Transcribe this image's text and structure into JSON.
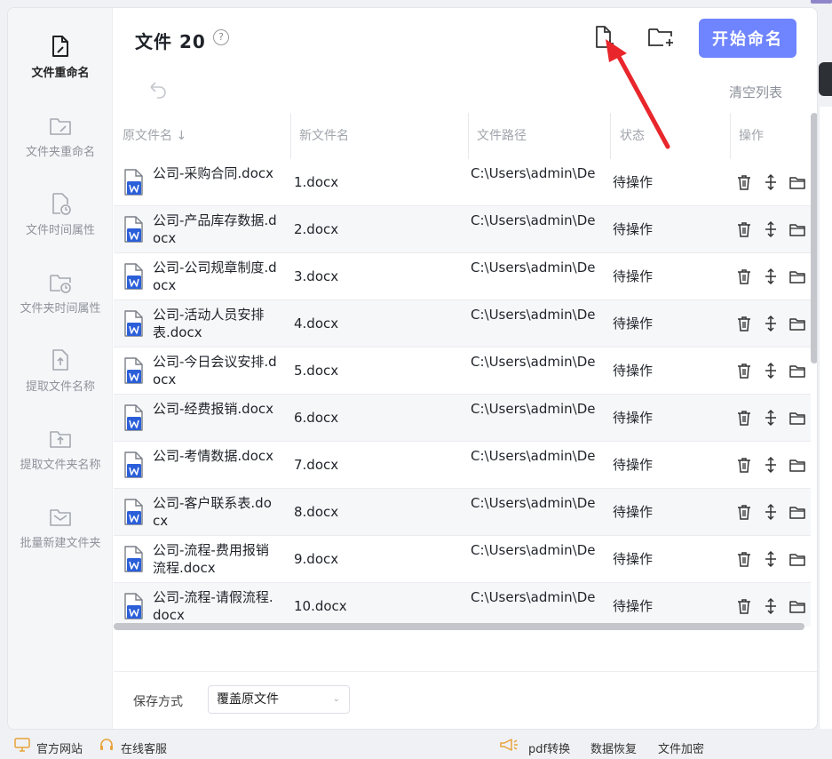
{
  "sidebar": {
    "items": [
      {
        "label": "文件重命名",
        "icon": "file-edit-icon",
        "active": true
      },
      {
        "label": "文件夹重命名",
        "icon": "folder-edit-icon"
      },
      {
        "label": "文件时间属性",
        "icon": "file-clock-icon"
      },
      {
        "label": "文件夹时间属性",
        "icon": "folder-clock-icon"
      },
      {
        "label": "提取文件名称",
        "icon": "file-upload-icon"
      },
      {
        "label": "提取文件夹名称",
        "icon": "folder-upload-icon"
      },
      {
        "label": "批量新建文件夹",
        "icon": "folder-mail-icon"
      }
    ]
  },
  "header": {
    "title": "文件 20",
    "help": "?",
    "start_label": "开始命名",
    "clear_label": "清空列表"
  },
  "table": {
    "columns": [
      "原文件名",
      "新文件名",
      "文件路径",
      "状态",
      "操作"
    ],
    "rows": [
      {
        "name": "公司-采购合同.docx",
        "new": "1.docx",
        "path": "C:\\Users\\admin\\Desktop\\测试文件\\...",
        "status": "待操作"
      },
      {
        "name": "公司-产品库存数据.docx",
        "new": "2.docx",
        "path": "C:\\Users\\admin\\Desktop\\测试文件\\...",
        "status": "待操作"
      },
      {
        "name": "公司-公司规章制度.docx",
        "new": "3.docx",
        "path": "C:\\Users\\admin\\Desktop\\测试文件\\...",
        "status": "待操作"
      },
      {
        "name": "公司-活动人员安排表.docx",
        "new": "4.docx",
        "path": "C:\\Users\\admin\\Desktop\\测试文件\\...",
        "status": "待操作"
      },
      {
        "name": "公司-今日会议安排.docx",
        "new": "5.docx",
        "path": "C:\\Users\\admin\\Desktop\\测试文件\\...",
        "status": "待操作"
      },
      {
        "name": "公司-经费报销.docx",
        "new": "6.docx",
        "path": "C:\\Users\\admin\\Desktop\\测试文件\\...",
        "status": "待操作"
      },
      {
        "name": "公司-考情数据.docx",
        "new": "7.docx",
        "path": "C:\\Users\\admin\\Desktop\\测试文件\\...",
        "status": "待操作"
      },
      {
        "name": "公司-客户联系表.docx",
        "new": "8.docx",
        "path": "C:\\Users\\admin\\Desktop\\测试文件\\...",
        "status": "待操作"
      },
      {
        "name": "公司-流程-费用报销流程.docx",
        "new": "9.docx",
        "path": "C:\\Users\\admin\\Desktop\\测试文件\\...",
        "status": "待操作"
      },
      {
        "name": "公司-流程-请假流程.docx",
        "new": "10.docx",
        "path": "C:\\Users\\admin\\Desktop\\测试文件\\...",
        "status": "待操作"
      }
    ]
  },
  "footer": {
    "save_label": "保存方式",
    "save_value": "覆盖原文件"
  },
  "bottombar": {
    "website": "官方网站",
    "service": "在线客服",
    "pdf": "pdf转换",
    "recover": "数据恢复",
    "encrypt": "文件加密"
  },
  "colors": {
    "accent": "#6f84ff",
    "word_blue": "#2b5fd9",
    "arrow_red": "#e8262b"
  }
}
